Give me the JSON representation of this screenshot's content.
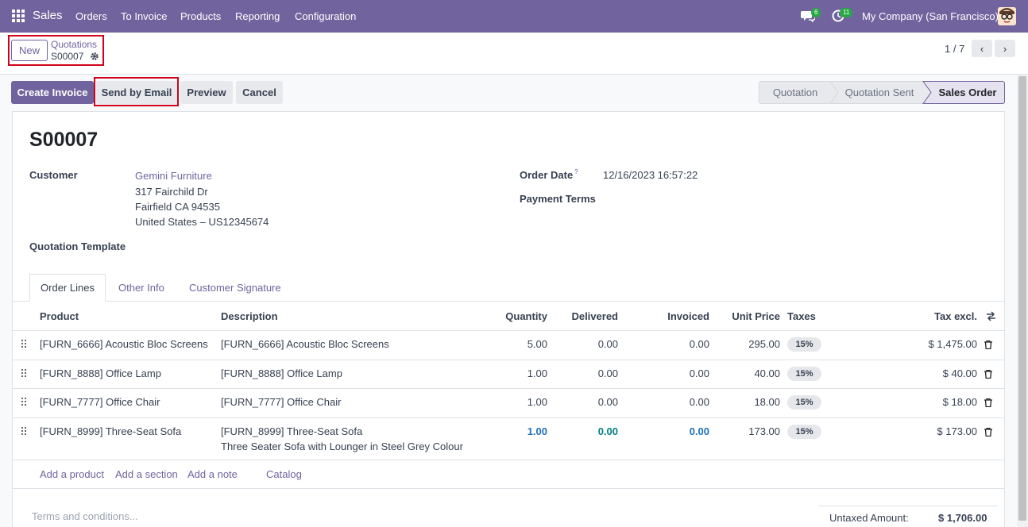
{
  "navbar": {
    "app_name": "Sales",
    "menu": [
      "Orders",
      "To Invoice",
      "Products",
      "Reporting",
      "Configuration"
    ],
    "chat_count": "6",
    "activity_count": "11",
    "company": "My Company (San Francisco)"
  },
  "control_panel": {
    "new_label": "New",
    "breadcrumb_parent": "Quotations",
    "breadcrumb_current": "S00007",
    "pager": "1 / 7"
  },
  "actions": {
    "create_invoice": "Create Invoice",
    "send_by_email": "Send by Email",
    "preview": "Preview",
    "cancel": "Cancel"
  },
  "statusbar": [
    "Quotation",
    "Quotation Sent",
    "Sales Order"
  ],
  "form": {
    "title": "S00007",
    "customer_label": "Customer",
    "customer_name": "Gemini Furniture",
    "address1": "317 Fairchild Dr",
    "address2": "Fairfield CA 94535",
    "address3": "United States – US12345674",
    "template_label": "Quotation Template",
    "order_date_label": "Order Date",
    "order_date_help": "?",
    "order_date": "12/16/2023 16:57:22",
    "payment_terms_label": "Payment Terms"
  },
  "tabs": [
    "Order Lines",
    "Other Info",
    "Customer Signature"
  ],
  "table": {
    "headers": [
      "Product",
      "Description",
      "Quantity",
      "Delivered",
      "Invoiced",
      "Unit Price",
      "Taxes",
      "Tax excl."
    ],
    "rows": [
      {
        "product": "[FURN_6666] Acoustic Bloc Screens",
        "description": "[FURN_6666] Acoustic Bloc Screens",
        "description2": "",
        "quantity": "5.00",
        "delivered": "0.00",
        "invoiced": "0.00",
        "unit_price": "295.00",
        "tax": "15%",
        "subtotal": "$ 1,475.00"
      },
      {
        "product": "[FURN_8888] Office Lamp",
        "description": "[FURN_8888] Office Lamp",
        "description2": "",
        "quantity": "1.00",
        "delivered": "0.00",
        "invoiced": "0.00",
        "unit_price": "40.00",
        "tax": "15%",
        "subtotal": "$ 40.00"
      },
      {
        "product": "[FURN_7777] Office Chair",
        "description": "[FURN_7777] Office Chair",
        "description2": "",
        "quantity": "1.00",
        "delivered": "0.00",
        "invoiced": "0.00",
        "unit_price": "18.00",
        "tax": "15%",
        "subtotal": "$ 18.00"
      },
      {
        "product": "[FURN_8999] Three-Seat Sofa",
        "description": "[FURN_8999] Three-Seat Sofa",
        "description2": "Three Seater Sofa with Lounger in Steel Grey Colour",
        "quantity": "1.00",
        "delivered": "0.00",
        "invoiced": "0.00",
        "unit_price": "173.00",
        "tax": "15%",
        "subtotal": "$ 173.00"
      }
    ],
    "add_product": "Add a product",
    "add_section": "Add a section",
    "add_note": "Add a note",
    "catalog": "Catalog"
  },
  "footer": {
    "terms_placeholder": "Terms and conditions...",
    "untaxed_label": "Untaxed Amount:",
    "untaxed_value": "$ 1,706.00"
  },
  "colors": {
    "brand": "#71639e",
    "highlight_box": "#d0021b"
  }
}
